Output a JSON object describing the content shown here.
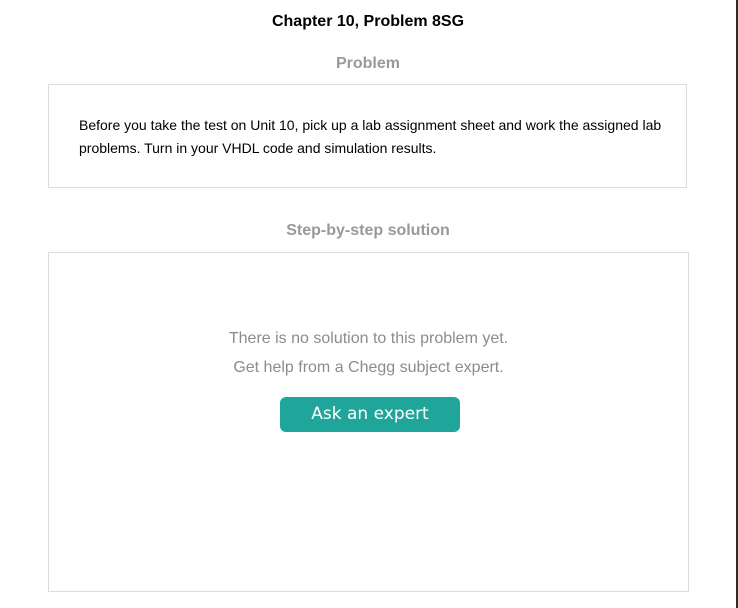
{
  "header": {
    "title": "Chapter 10, Problem 8SG"
  },
  "problem": {
    "heading": "Problem",
    "text": "Before you take the test on Unit 10, pick up a lab assignment sheet and work the assigned lab problems. Turn in your VHDL code and simulation results."
  },
  "solution": {
    "heading": "Step-by-step solution",
    "empty_message": "There is no solution to this problem yet.",
    "help_message": "Get help from a Chegg subject expert.",
    "button_label": "Ask an expert"
  },
  "colors": {
    "accent": "#20a59a",
    "heading_gray": "#999999",
    "border": "#dcdcdc"
  }
}
